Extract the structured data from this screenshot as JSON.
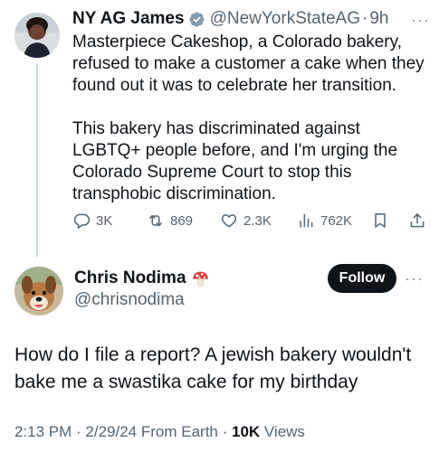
{
  "original_tweet": {
    "display_name": "NY AG James",
    "handle": "@NewYorkStateAG",
    "separator": "·",
    "time_ago": "9h",
    "more_glyph": "···",
    "text": "Masterpiece Cakeshop, a Colorado bakery, refused to make a customer a cake when they found out it was to celebrate her transition.\n\nThis bakery has discriminated against LGBTQ+ people before, and I'm urging the Colorado Supreme Court to stop this transphobic discrimination.",
    "actions": {
      "replies": "3K",
      "reposts": "869",
      "likes": "2.3K",
      "views": "762K"
    },
    "icons": {
      "verified": "verified-badge-icon",
      "reply": "reply-bubble-icon",
      "repost": "repost-icon",
      "like": "heart-icon",
      "views": "bar-chart-icon",
      "bookmark": "bookmark-icon",
      "share": "share-icon"
    }
  },
  "reply_tweet": {
    "display_name": "Chris Nodima",
    "handle": "@chrisnodima",
    "follow_label": "Follow",
    "more_glyph": "···",
    "text": "How do I file a report? A jewish bakery wouldn't bake me a swastika cake for my birthday",
    "timestamp": "2:13 PM · 2/29/24 From Earth · ",
    "views_count": "10K",
    "views_label": " Views",
    "icons": {
      "name_emoji": "mushroom-icon"
    }
  },
  "colors": {
    "text_primary": "#0f1419",
    "text_secondary": "#536471",
    "verified_blue": "#829aab",
    "divider": "#cfd9de",
    "follow_bg": "#0f1419"
  }
}
